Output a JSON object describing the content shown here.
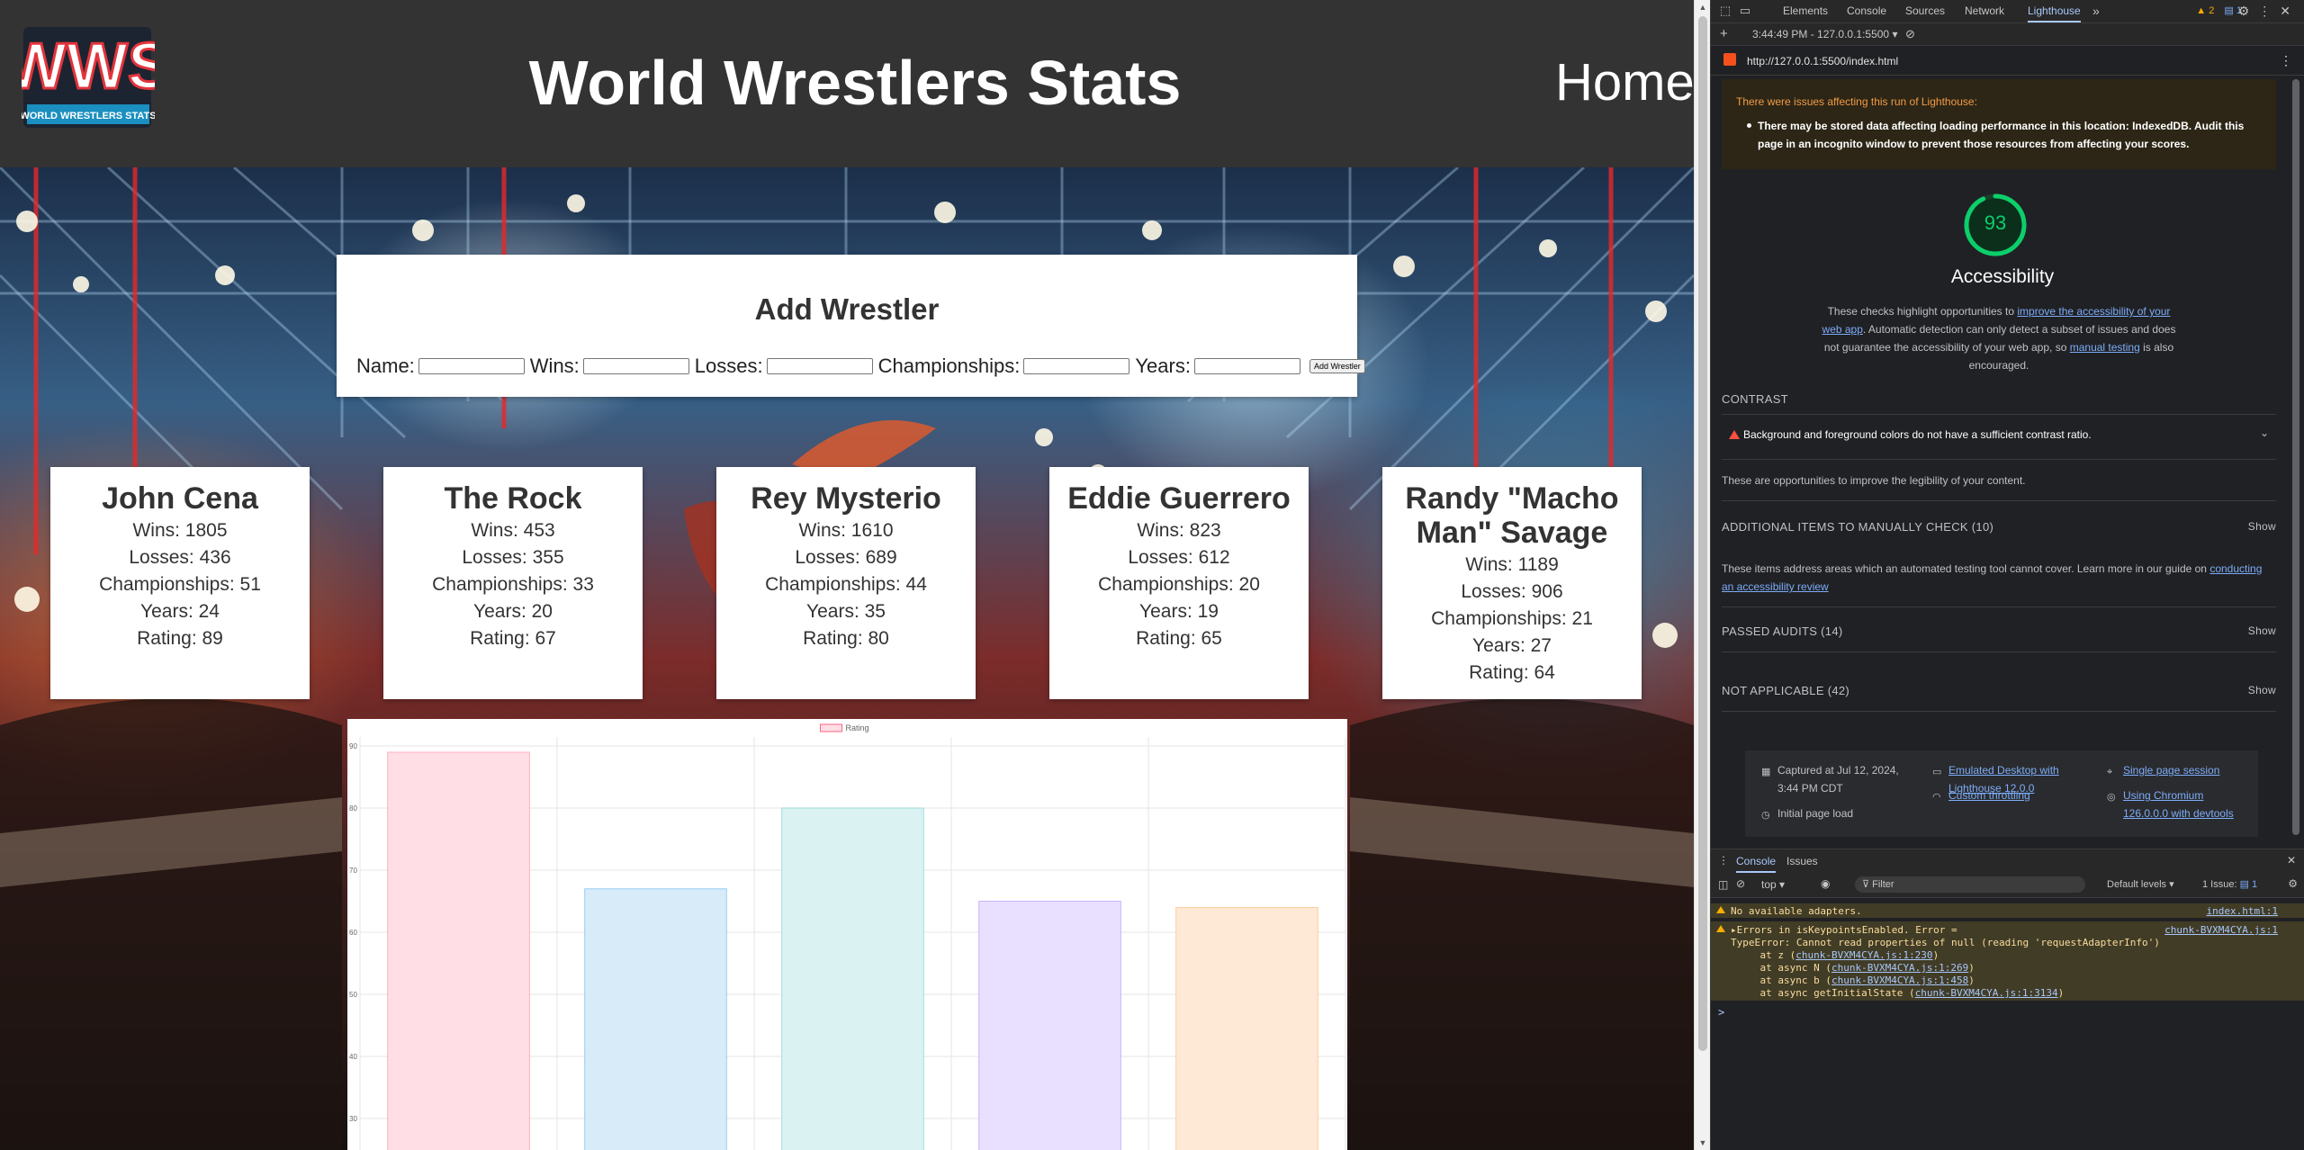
{
  "site": {
    "logo_text": "WWS",
    "logo_subtext": "WORLD WRESTLERS STATS",
    "title": "World Wrestlers Stats",
    "nav_home": "Home"
  },
  "form": {
    "heading": "Add Wrestler",
    "name_label": "Name:",
    "wins_label": "Wins:",
    "losses_label": "Losses:",
    "championships_label": "Championships:",
    "years_label": "Years:",
    "submit_label": "Add Wrestler"
  },
  "wrestlers": [
    {
      "name": "John Cena",
      "wins": "Wins: 1805",
      "losses": "Losses: 436",
      "championships": "Championships: 51",
      "years": "Years: 24",
      "rating": "Rating: 89"
    },
    {
      "name": "The Rock",
      "wins": "Wins: 453",
      "losses": "Losses: 355",
      "championships": "Championships: 33",
      "years": "Years: 20",
      "rating": "Rating: 67"
    },
    {
      "name": "Rey Mysterio",
      "wins": "Wins: 1610",
      "losses": "Losses: 689",
      "championships": "Championships: 44",
      "years": "Years: 35",
      "rating": "Rating: 80"
    },
    {
      "name": "Eddie Guerrero",
      "wins": "Wins: 823",
      "losses": "Losses: 612",
      "championships": "Championships: 20",
      "years": "Years: 19",
      "rating": "Rating: 65"
    },
    {
      "name": "Randy \"Macho Man\" Savage",
      "wins": "Wins: 1189",
      "losses": "Losses: 906",
      "championships": "Championships: 21",
      "years": "Years: 27",
      "rating": "Rating: 64"
    }
  ],
  "chart_data": {
    "type": "bar",
    "legend_label": "Rating",
    "legend_position": "top",
    "grid": true,
    "values": [
      89,
      67,
      80,
      65,
      64
    ],
    "y_ticks": [
      90,
      80,
      70,
      60,
      50,
      40,
      30
    ],
    "colors": [
      "#ffdfe5",
      "#d7ebf8",
      "#dbf2f2",
      "#e9e0ff",
      "#fde9d6"
    ],
    "border_colors": [
      "#ff6384",
      "#36a2eb",
      "#4bc0c0",
      "#9966ff",
      "#ff9f40"
    ]
  },
  "devtools": {
    "tabs": [
      "Elements",
      "Console",
      "Sources",
      "Network",
      "Lighthouse"
    ],
    "active_tab": "Lighthouse",
    "more": "»",
    "warn_count": "2",
    "info_count": "1",
    "report_time": "3:44:49 PM - 127.0.0.1:5500",
    "url": "http://127.0.0.1:5500/index.html",
    "warning_heading": "There were issues affecting this run of Lighthouse:",
    "warning_item": "There may be stored data affecting loading performance in this location: IndexedDB. Audit this page in an incognito window to prevent those resources from affecting your scores.",
    "score": "93",
    "score_fraction": 0.93,
    "category": "Accessibility",
    "desc_1": "These checks highlight opportunities to ",
    "desc_link_1": "improve the accessibility of your web app",
    "desc_2": ". Automatic detection can only detect a subset of issues and does not guarantee the accessibility of your web app, so ",
    "desc_link_2": "manual testing",
    "desc_3": " is also encouraged.",
    "contrast_heading": "CONTRAST",
    "contrast_item": "Background and foreground colors do not have a sufficient contrast ratio.",
    "contrast_note": "These are opportunities to improve the legibility of your content.",
    "manual_heading": "ADDITIONAL ITEMS TO MANUALLY CHECK (10)",
    "show": "Show",
    "manual_note": "These items address areas which an automated testing tool cannot cover. Learn more in our guide on ",
    "manual_link": "conducting an accessibility review",
    "passed_heading": "PASSED AUDITS (14)",
    "na_heading": "NOT APPLICABLE (42)",
    "captured": "Captured at Jul 12, 2024, 3:44 PM CDT",
    "initial_load": "Initial page load",
    "emulated": "Emulated Desktop with Lighthouse 12.0.0",
    "throttling": "Custom throttling",
    "single_session": "Single page session",
    "chromium": "Using Chromium 126.0.0.0 with devtools",
    "drawer_tabs": [
      "Console",
      "Issues"
    ],
    "context": "top",
    "filter_placeholder": "Filter",
    "levels": "Default levels",
    "issues_count": "1 Issue:",
    "issues_badge": "1",
    "msg1": "No available adapters.",
    "msg1_src": "index.html:1",
    "msg2_head": "▸Errors in isKeypointsEnabled. Error =",
    "msg2_src": "chunk-BVXM4CYA.js:1",
    "msg2_line2": "TypeError: Cannot read properties of null (reading 'requestAdapterInfo')",
    "stack": [
      {
        "pre": "    at z (",
        "link": "chunk-BVXM4CYA.js:1:230",
        "post": ")"
      },
      {
        "pre": "    at async N (",
        "link": "chunk-BVXM4CYA.js:1:269",
        "post": ")"
      },
      {
        "pre": "    at async b (",
        "link": "chunk-BVXM4CYA.js:1:458",
        "post": ")"
      },
      {
        "pre": "    at async getInitialState (",
        "link": "chunk-BVXM4CYA.js:1:3134",
        "post": ")"
      }
    ],
    "prompt": ">"
  }
}
